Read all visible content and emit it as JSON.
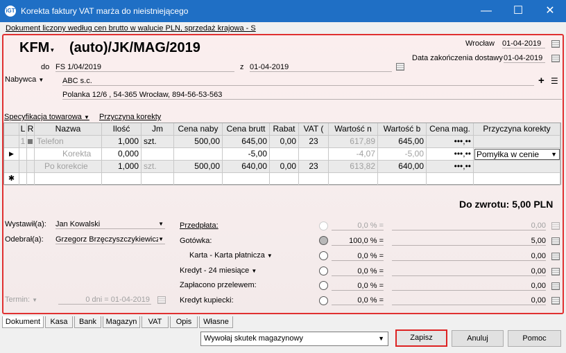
{
  "window": {
    "title": "Korekta faktury VAT marża do nieistniejącego",
    "app_icon": "iGT",
    "minimize": "—",
    "maximize": "☐",
    "close": "✕"
  },
  "doc_line": "Dokument liczony według cen brutto w walucie PLN, sprzedaż krajowa - S",
  "header": {
    "type_label": "KFM",
    "number": "(auto)/JK/MAG/2019",
    "city": "Wrocław",
    "issue_date": "01-04-2019",
    "delivery_label": "Data zakończenia dostawy",
    "delivery_date": "01-04-2019",
    "do_label": "do",
    "do_value": "FS 1/04/2019",
    "z_label": "z",
    "z_value": "01-04-2019",
    "buyer_label": "Nabywca",
    "buyer_name": "ABC s.c.",
    "buyer_address": "Polanka 12/6 , 54-365 Wrocław, 894-56-53-563"
  },
  "links": {
    "spec": "Specyfikacja towarowa",
    "reason": "Przyczyna korekty"
  },
  "table": {
    "columns": [
      "L",
      "R",
      "Nazwa",
      "Ilość",
      "Jm",
      "Cena naby",
      "Cena brutt",
      "Rabat",
      "VAT (",
      "Wartość n",
      "Wartość b",
      "Cena mag.",
      "Przyczyna korekty"
    ],
    "rows": [
      {
        "lp": "1",
        "name": "Telefon",
        "qty": "1,000",
        "unit": "szt.",
        "buy": "500,00",
        "gross": "645,00",
        "rabat": "0,00",
        "vat": "23",
        "net": "617,89",
        "brut": "645,00",
        "mag": "•••,••",
        "reason": ""
      },
      {
        "lp": "",
        "name": "Korekta",
        "qty": "0,000",
        "unit": "",
        "buy": "",
        "gross": "-5,00",
        "rabat": "",
        "vat": "",
        "net": "-4,07",
        "brut": "-5,00",
        "mag": "•••,••",
        "reason": "Pomyłka w cenie"
      },
      {
        "lp": "",
        "name": "Po korekcie",
        "qty": "1,000",
        "unit": "szt.",
        "buy": "500,00",
        "gross": "640,00",
        "rabat": "0,00",
        "vat": "23",
        "net": "613,82",
        "brut": "640,00",
        "mag": "•••,••",
        "reason": ""
      }
    ],
    "new_row_marker": "✱"
  },
  "summary": "Do zwrotu: 5,00 PLN",
  "people": {
    "issued_label": "Wystawił(a):",
    "issued_value": "Jan Kowalski",
    "received_label": "Odebrał(a):",
    "received_value": "Grzegorz Brzęczyszczykiewicz"
  },
  "term": {
    "label": "Termin:",
    "days": "0 dni =",
    "date": "01-04-2019"
  },
  "payments": [
    {
      "label": "Przedpłata:",
      "percent": "0,0 % =",
      "amount": "0,00",
      "state": "disabled"
    },
    {
      "label": "Gotówka:",
      "percent": "100,0 % =",
      "amount": "5,00",
      "state": "selected"
    },
    {
      "label": "Karta - Karta płatnicza",
      "percent": "0,0 % =",
      "amount": "0,00",
      "state": "normal"
    },
    {
      "label": "Kredyt - 24 miesiące",
      "percent": "0,0 % =",
      "amount": "0,00",
      "state": "normal"
    },
    {
      "label": "Zapłacono przelewem:",
      "percent": "0,0 % =",
      "amount": "0,00",
      "state": "normal"
    },
    {
      "label": "Kredyt kupiecki:",
      "percent": "0,0 % =",
      "amount": "0,00",
      "state": "normal"
    }
  ],
  "tabs": [
    "Dokument",
    "Kasa",
    "Bank",
    "Magazyn",
    "VAT",
    "Opis",
    "Własne"
  ],
  "footer": {
    "warehouse_select": "Wywołaj skutek magazynowy",
    "save": "Zapisz",
    "cancel": "Anuluj",
    "help": "Pomoc"
  }
}
